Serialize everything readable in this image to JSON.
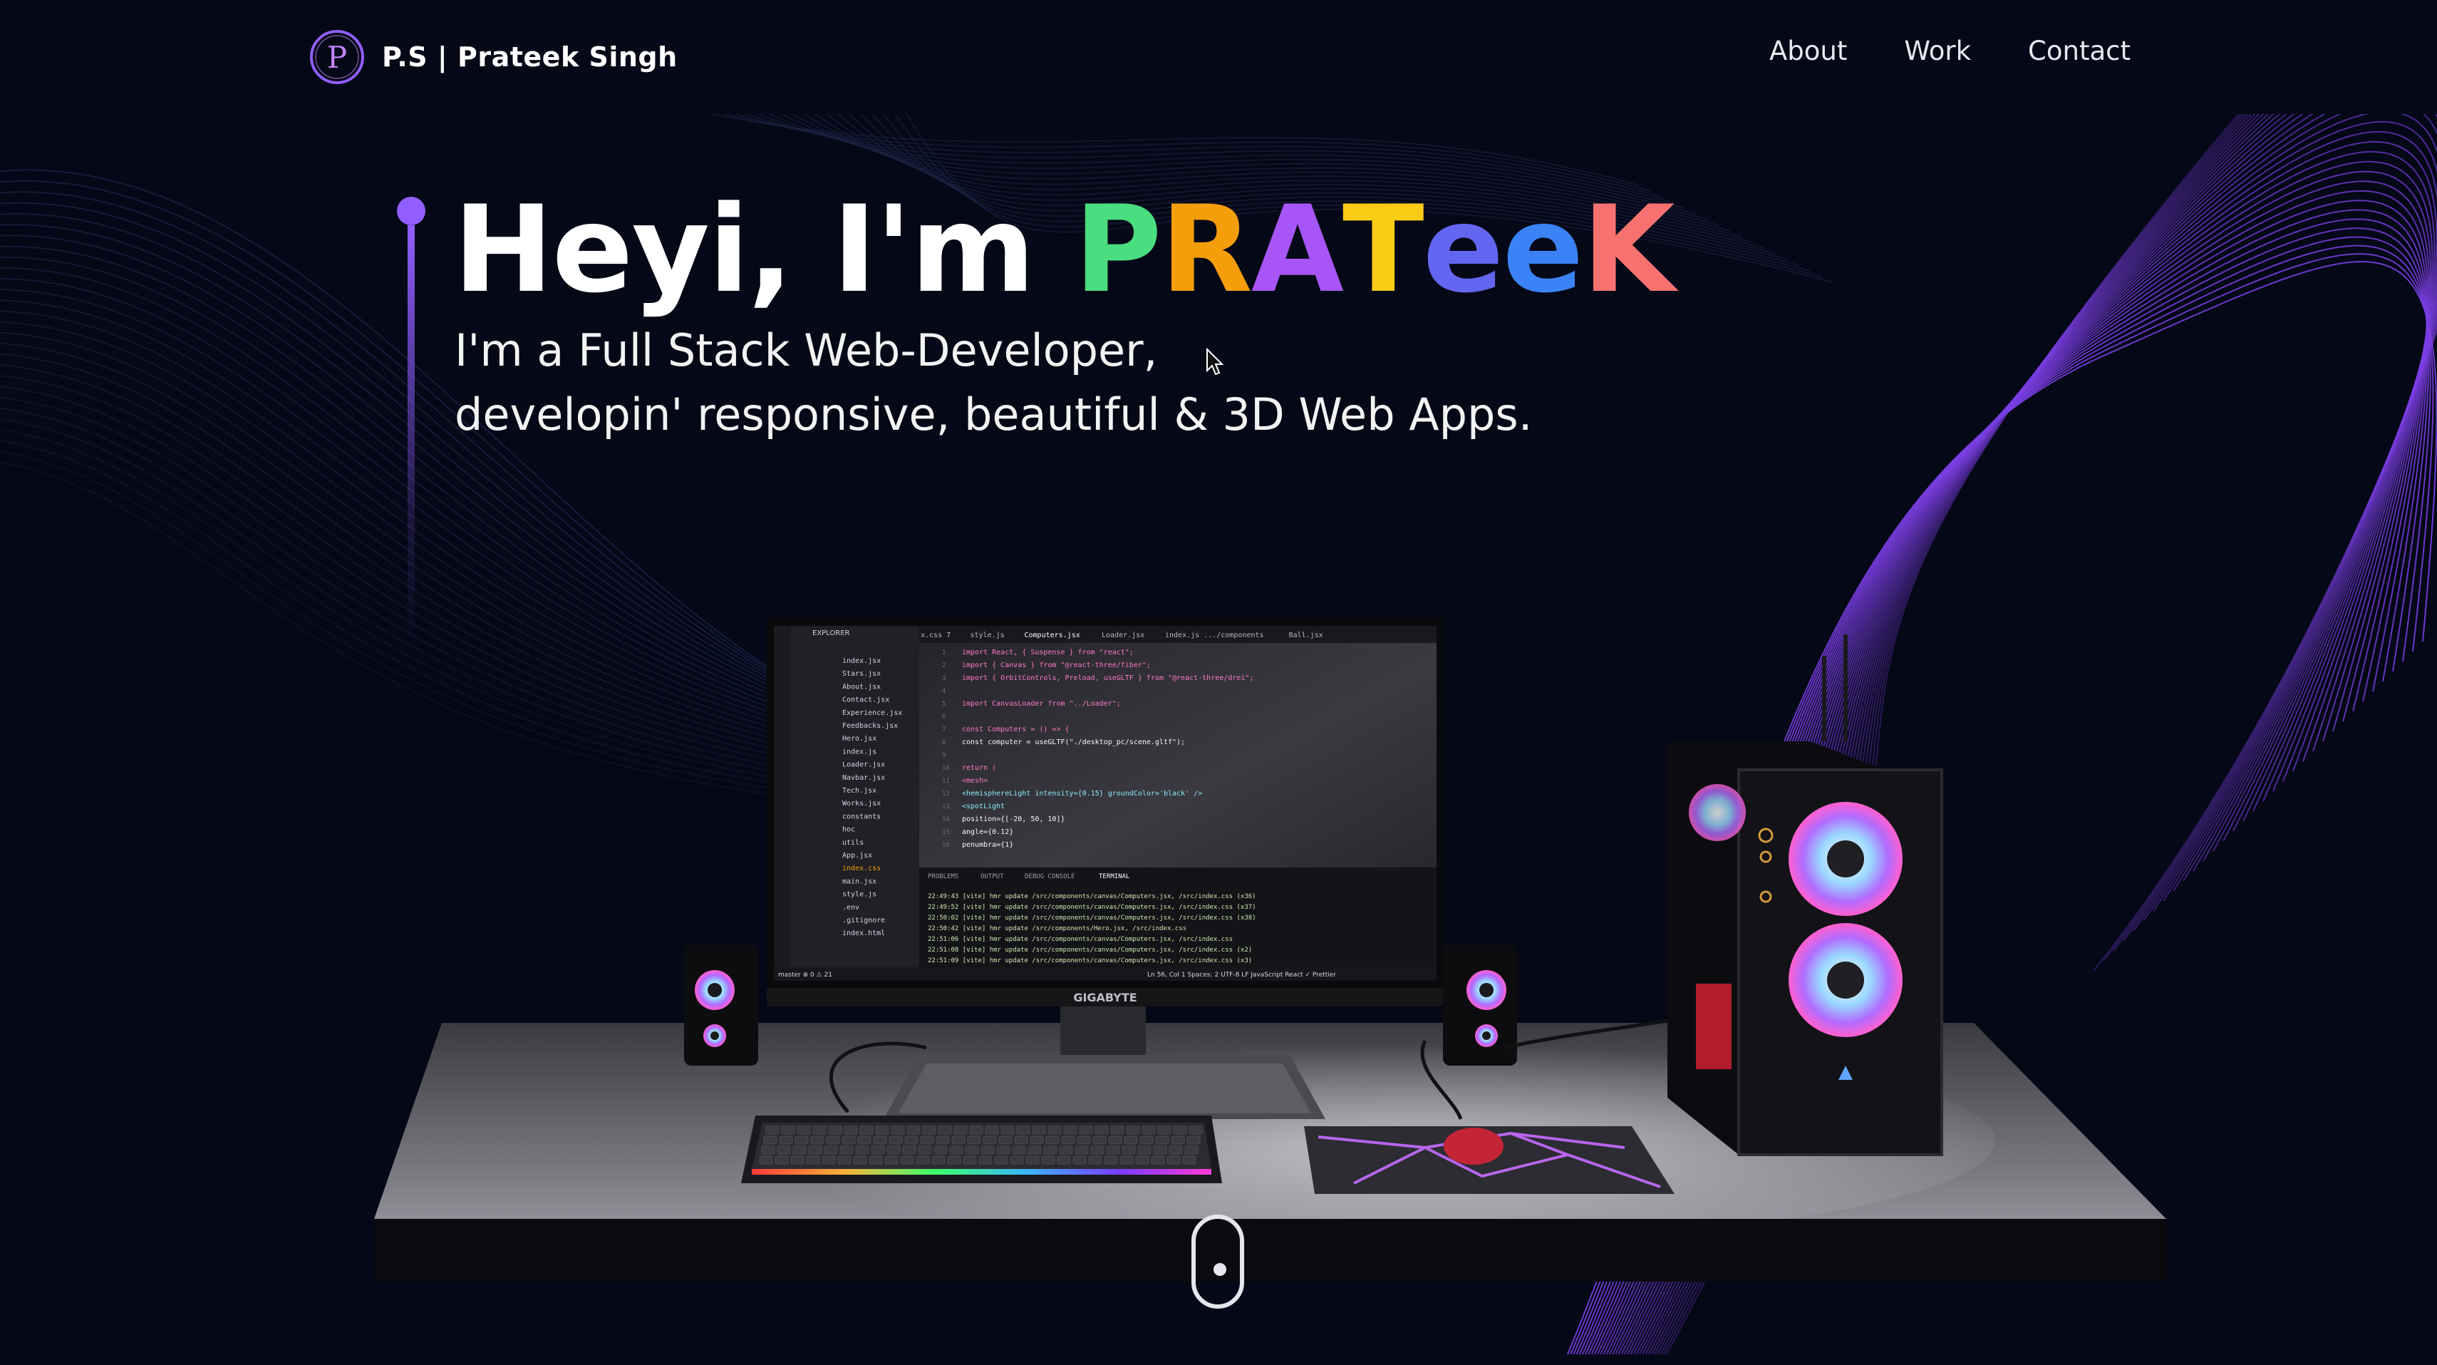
{
  "brand": {
    "logo_letter": "P",
    "name": "P.S | Prateek Singh"
  },
  "nav": {
    "items": [
      "About",
      "Work",
      "Contact"
    ]
  },
  "hero": {
    "greeting": "Heyi, I'm ",
    "name_letters": [
      {
        "char": "P",
        "color": "#4ade80"
      },
      {
        "char": "R",
        "color": "#f59e0b"
      },
      {
        "char": "A",
        "color": "#a855f7"
      },
      {
        "char": "T",
        "color": "#facc15"
      },
      {
        "char": "e",
        "color": "#6366f1"
      },
      {
        "char": "e",
        "color": "#3b82f6"
      },
      {
        "char": "K",
        "color": "#f87171"
      }
    ],
    "subtitle_line1": "I'm a Full Stack Web-Developer,",
    "subtitle_line2": "developin' responsive, beautiful & 3D Web Apps."
  },
  "scene": {
    "monitor_brand": "GIGABYTE",
    "editor": {
      "explorer_title": "EXPLORER",
      "tabs": [
        "x.css 7",
        "style.js",
        "Computers.jsx",
        "Loader.jsx",
        "index.js .../components",
        "Ball.jsx"
      ],
      "files": [
        "index.jsx",
        "Stars.jsx",
        "About.jsx",
        "Contact.jsx",
        "Experience.jsx",
        "Feedbacks.jsx",
        "Hero.jsx",
        "index.js",
        "Loader.jsx",
        "Navbar.jsx",
        "Tech.jsx",
        "Works.jsx",
        "constants",
        "hoc",
        "utils",
        "App.jsx",
        "index.css",
        "main.jsx",
        "style.js",
        ".env",
        ".gitignore",
        "index.html"
      ],
      "code": [
        "import React, { Suspense } from \"react\";",
        "import { Canvas } from \"@react-three/fiber\";",
        "import { OrbitControls, Preload, useGLTF } from \"@react-three/drei\";",
        "",
        "import CanvasLoader from \"../Loader\";",
        "",
        "const Computers = () => {",
        "  const computer = useGLTF(\"./desktop_pc/scene.gltf\");",
        "",
        "  return (",
        "    <mesh>",
        "      <hemisphereLight intensity={0.15} groundColor='black' />",
        "      <spotLight",
        "        position={[-20, 50, 10]}",
        "        angle={0.12}",
        "        penumbra={1}"
      ],
      "panel_tabs": [
        "PROBLEMS",
        "OUTPUT",
        "DEBUG CONSOLE",
        "TERMINAL"
      ],
      "terminal": [
        "22:49:43 [vite] hmr update /src/components/canvas/Computers.jsx, /src/index.css (x36)",
        "22:49:52 [vite] hmr update /src/components/canvas/Computers.jsx, /src/index.css (x37)",
        "22:50:02 [vite] hmr update /src/components/canvas/Computers.jsx, /src/index.css (x38)",
        "22:50:42 [vite] hmr update /src/components/Hero.jsx, /src/index.css",
        "22:51:06 [vite] hmr update /src/components/canvas/Computers.jsx, /src/index.css",
        "22:51:08 [vite] hmr update /src/components/canvas/Computers.jsx, /src/index.css (x2)",
        "22:51:09 [vite] hmr update /src/components/canvas/Computers.jsx, /src/index.css (x3)"
      ],
      "status_left": "master  ⊗ 0 ⚠ 21",
      "status_right": "Ln 56, Col 1   Spaces: 2   UTF-8   LF   JavaScript React   ✓ Prettier"
    }
  },
  "colors": {
    "background": "#050816",
    "accent": "#915eff",
    "wave": "#7b3fe4"
  },
  "icons": {
    "logo": "p-monogram-logo",
    "scroll": "scroll-indicator-icon",
    "cursor": "mouse-pointer-icon"
  }
}
